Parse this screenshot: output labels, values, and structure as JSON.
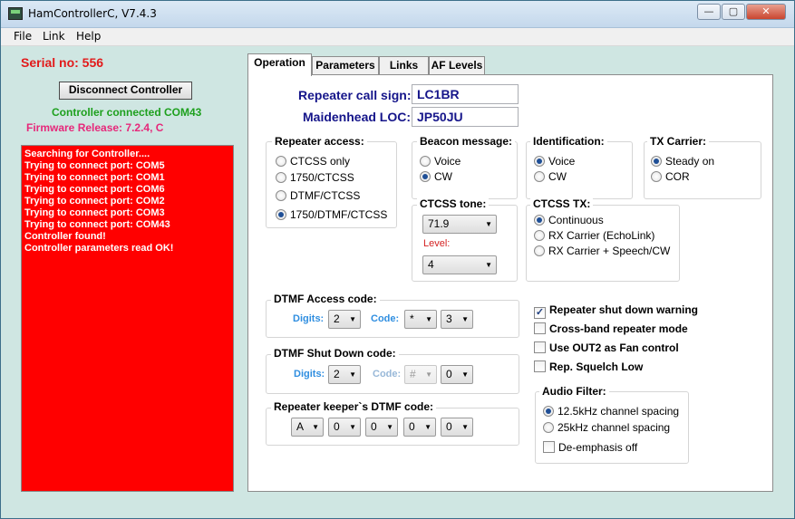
{
  "window": {
    "title": "HamControllerC, V7.4.3",
    "controls": {
      "minimize": "—",
      "maximize": "▢",
      "close": "✕"
    }
  },
  "menu": [
    "File",
    "Link",
    "Help"
  ],
  "left_panel": {
    "serial": "Serial no: 556",
    "disconnect_label": "Disconnect Controller",
    "connection_status": "Controller connected COM43",
    "firmware": "Firmware Release: 7.2.4, C",
    "log": [
      "Searching for Controller....",
      "Trying to connect port: COM5",
      "Trying to connect port: COM1",
      "Trying to connect port: COM6",
      "Trying to connect port: COM2",
      "Trying to connect port: COM3",
      "Trying to connect port: COM43",
      "Controller found!",
      "Controller parameters read OK!"
    ]
  },
  "tabs": [
    "Operation",
    "Parameters",
    "Links",
    "AF Levels"
  ],
  "operation": {
    "callsign_label": "Repeater call sign:",
    "callsign_value": "LC1BR",
    "locator_label": "Maidenhead LOC:",
    "locator_value": "JP50JU",
    "repeater_access": {
      "title": "Repeater access:",
      "options": [
        "CTCSS only",
        "1750/CTCSS",
        "DTMF/CTCSS",
        "1750/DTMF/CTCSS"
      ],
      "selected": 3
    },
    "beacon": {
      "title": "Beacon message:",
      "options": [
        "Voice",
        "CW"
      ],
      "selected": 1
    },
    "identification": {
      "title": "Identification:",
      "options": [
        "Voice",
        "CW"
      ],
      "selected": 0
    },
    "tx_carrier": {
      "title": "TX Carrier:",
      "options": [
        "Steady on",
        "COR"
      ],
      "selected": 0
    },
    "ctcss_tone": {
      "title": "CTCSS tone:",
      "tone": "71.9",
      "level_label": "Level:",
      "level": "4"
    },
    "ctcss_tx": {
      "title": "CTCSS TX:",
      "options": [
        "Continuous",
        "RX Carrier (EchoLink)",
        "RX Carrier + Speech/CW"
      ],
      "selected": 0
    },
    "dtmf_access": {
      "title": "DTMF Access code:",
      "digits_label": "Digits:",
      "digits": "2",
      "code_label": "Code:",
      "code": [
        "*",
        "3"
      ]
    },
    "dtmf_shutdown": {
      "title": "DTMF Shut Down code:",
      "digits_label": "Digits:",
      "digits": "2",
      "code_label": "Code:",
      "code": [
        "#",
        "0"
      ]
    },
    "keeper": {
      "title": "Repeater keeper`s DTMF code:",
      "code": [
        "A",
        "0",
        "0",
        "0",
        "0"
      ]
    },
    "checkboxes": [
      {
        "label": "Repeater shut down warning",
        "checked": true
      },
      {
        "label": "Cross-band repeater mode",
        "checked": false
      },
      {
        "label": "Use OUT2 as Fan control",
        "checked": false
      },
      {
        "label": "Rep. Squelch Low",
        "checked": false
      }
    ],
    "audio_filter": {
      "title": "Audio Filter:",
      "options": [
        "12.5kHz channel spacing",
        "25kHz channel spacing"
      ],
      "selected": 0,
      "deemphasis_label": "De-emphasis off",
      "deemphasis_checked": false
    }
  },
  "colors": {
    "log_bg": "#ff0000",
    "serial": "#e21a1a",
    "status": "#1ea01e",
    "firmware": "#e6287a",
    "label_blue": "#15158a"
  }
}
